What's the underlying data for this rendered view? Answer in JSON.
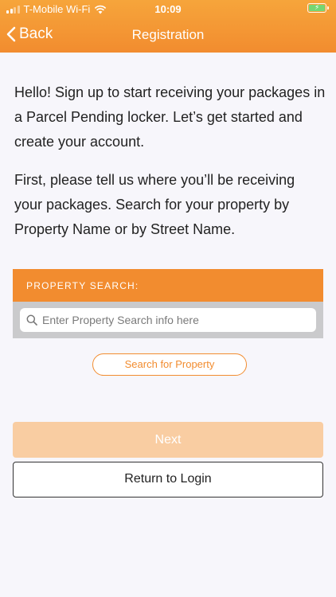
{
  "status_bar": {
    "carrier": "T-Mobile Wi-Fi",
    "time": "10:09",
    "battery_level": 1.0
  },
  "nav": {
    "back_label": "Back",
    "title": "Registration"
  },
  "intro": {
    "paragraph1": "Hello! Sign up to start receiving your packages in a Parcel Pending locker. Let’s get started and create your account.",
    "paragraph2": "First, please tell us where you’ll be receiving your packages. Search for your property by Property Name or by Street Name."
  },
  "property_search": {
    "header": "PROPERTY SEARCH:",
    "input_value": "",
    "placeholder": "Enter Property Search info here",
    "button_label": "Search for Property"
  },
  "actions": {
    "next_label": "Next",
    "return_label": "Return to Login"
  },
  "colors": {
    "accent": "#f28c2f",
    "disabled_button": "#f9cda2",
    "background": "#f7f6fb"
  },
  "icons": [
    "signal-icon",
    "wifi-icon",
    "battery-icon",
    "chevron-left-icon",
    "search-icon"
  ]
}
